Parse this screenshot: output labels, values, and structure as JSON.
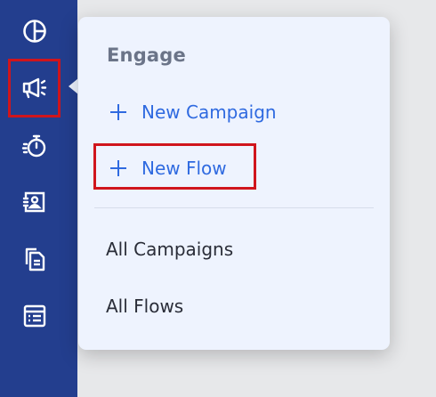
{
  "sidebar": {
    "icons": [
      "pie-chart-icon",
      "megaphone-icon",
      "stopwatch-icon",
      "contact-card-icon",
      "documents-icon",
      "table-list-icon"
    ],
    "background": "#233e8e"
  },
  "menu": {
    "title": "Engage",
    "actions": [
      {
        "label": "New Campaign",
        "icon": "plus-icon"
      },
      {
        "label": "New Flow",
        "icon": "plus-icon"
      }
    ],
    "links": [
      "All Campaigns",
      "All Flows"
    ]
  },
  "colors": {
    "accent": "#2f6ae0",
    "highlight": "#d0151c",
    "menu_background": "#eef3fe",
    "title": "#6b7488"
  }
}
